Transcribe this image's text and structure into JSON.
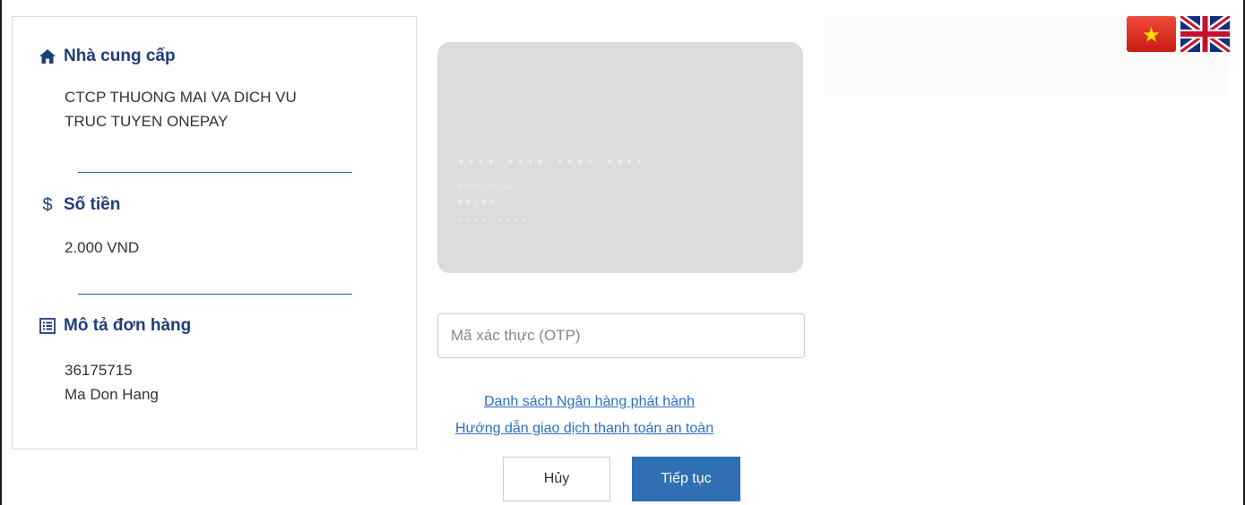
{
  "provider": {
    "title": "Nhà cung cấp",
    "name_line1": "CTCP THUONG MAI VA DICH VU",
    "name_line2": "TRUC TUYEN ONEPAY"
  },
  "amount": {
    "title": "Số tiền",
    "value": "2.000 VND"
  },
  "order": {
    "title": "Mô tả đơn hàng",
    "id": "36175715",
    "description": "Ma Don Hang"
  },
  "card": {
    "number_mask": "•••• •••• •••• ••••",
    "label": "MONTH/YEAR",
    "expiry_mask": "••/••",
    "name_mask": "•••• ••••"
  },
  "otp": {
    "placeholder": "Mã xác thực (OTP)"
  },
  "links": {
    "banks": "Danh sách Ngân hàng phát hành",
    "guide": "Hướng dẫn giao dịch thanh toán an toàn"
  },
  "buttons": {
    "cancel": "Hủy",
    "continue": "Tiếp tục"
  },
  "icons": {
    "provider": "home-icon",
    "amount": "dollar-icon",
    "order": "list-icon"
  },
  "colors": {
    "heading": "#1f3d7a",
    "primary_button": "#2f6fb3",
    "link": "#2a6ec4",
    "card": "#dcdcdc"
  },
  "languages": [
    "vi",
    "en"
  ]
}
